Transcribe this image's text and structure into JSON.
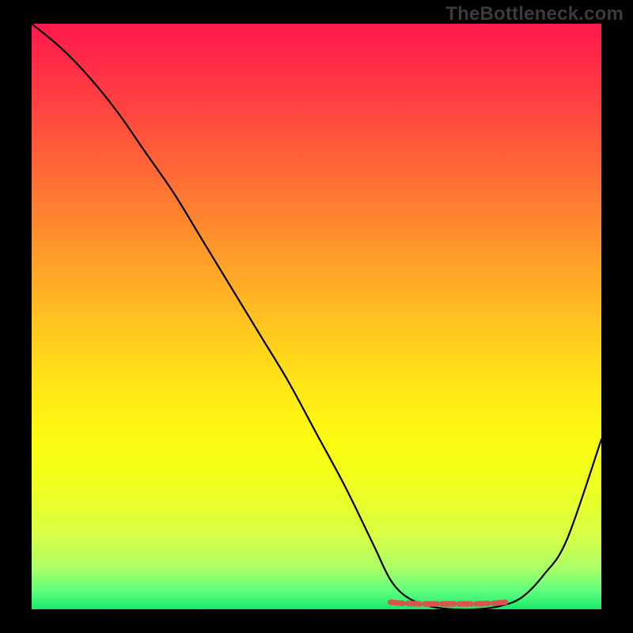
{
  "watermark": "TheBottleneck.com",
  "chart_data": {
    "type": "line",
    "title": "",
    "xlabel": "",
    "ylabel": "",
    "xlim": [
      0,
      100
    ],
    "ylim": [
      0,
      100
    ],
    "note": "Axes are unlabeled in the source image; x is a normalized horizontal position (0–100 left→right), y is a normalized vertical value (0 = bottom/green, 100 = top/red). Values estimated from pixel positions.",
    "series": [
      {
        "name": "black-curve",
        "x": [
          0,
          5,
          10,
          15,
          20,
          25,
          30,
          35,
          40,
          45,
          50,
          55,
          60,
          63,
          66,
          70,
          74,
          78,
          82,
          86,
          90,
          94,
          100
        ],
        "y": [
          100,
          96,
          91,
          85,
          78,
          71,
          63,
          55,
          47,
          39,
          30,
          21,
          11,
          5,
          2,
          0.5,
          0,
          0,
          0.5,
          2,
          6,
          12,
          29
        ]
      },
      {
        "name": "red-floor-dashes",
        "x": [
          63,
          66,
          69,
          72,
          75,
          78,
          81,
          84
        ],
        "y": [
          1.2,
          1.0,
          0.9,
          0.9,
          0.9,
          0.9,
          1.0,
          1.2
        ]
      }
    ],
    "colors": {
      "black_curve": "#000000",
      "red_dashes": "#d9544f",
      "gradient_top": "#ff1a4b",
      "gradient_bottom": "#17e86a"
    }
  }
}
